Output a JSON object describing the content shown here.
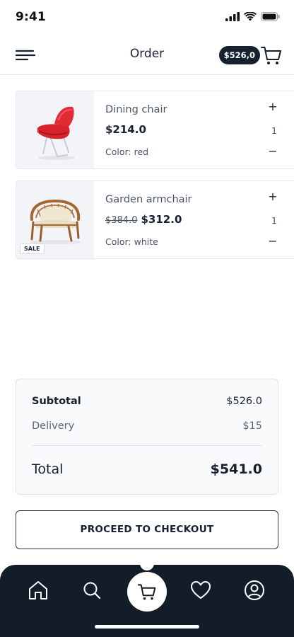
{
  "status_bar": {
    "time": "9:41"
  },
  "header": {
    "title": "Order",
    "cart_total": "$526,0",
    "menu_icon": "menu-icon",
    "cart_icon": "cart-icon"
  },
  "products": [
    {
      "name": "Dining chair",
      "old_price": "",
      "price": "$214.0",
      "color": "Color: red",
      "quantity": "1",
      "plus": "+",
      "minus": "−",
      "badge": ""
    },
    {
      "name": "Garden armchair",
      "old_price": "$384.0",
      "price": "$312.0",
      "color": "Color: white",
      "quantity": "1",
      "plus": "+",
      "minus": "−",
      "badge": "SALE"
    }
  ],
  "summary": {
    "subtotal_label": "Subtotal",
    "subtotal_value": "$526.0",
    "delivery_label": "Delivery",
    "delivery_value": "$15",
    "total_label": "Total",
    "total_value": "$541.0"
  },
  "checkout": {
    "label": "PROCEED TO CHECKOUT"
  },
  "bottom_nav": {
    "items": [
      "home-icon",
      "search-icon",
      "cart-icon",
      "heart-icon",
      "profile-icon"
    ],
    "active": "cart-icon"
  },
  "colors": {
    "dark": "#121d29",
    "accent_red": "#d8232f",
    "card_bg": "#f8fafc"
  }
}
